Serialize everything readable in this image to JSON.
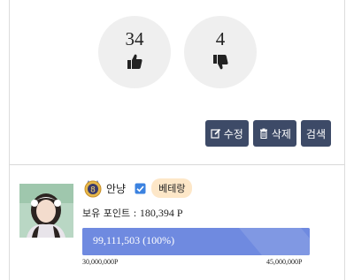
{
  "votes": {
    "up": {
      "count": "34",
      "icon": "thumbs-up-icon"
    },
    "down": {
      "count": "4",
      "icon": "thumbs-down-icon"
    }
  },
  "actions": {
    "edit_label": "수정",
    "delete_label": "삭제",
    "search_label": "검색",
    "button_color": "#3d4a67"
  },
  "profile": {
    "level": "8",
    "username": "안냥",
    "rank": "베테랑",
    "points_label": "보유 포인트 :",
    "points_value": "180,394 P",
    "progress_text": "99,111,503 (100%)",
    "progress_fraction": 1.0,
    "scale_min": "30,000,000P",
    "scale_max": "45,000,000P",
    "progress_color": "#7c97e6",
    "rank_badge_color": "#fde7c8"
  }
}
